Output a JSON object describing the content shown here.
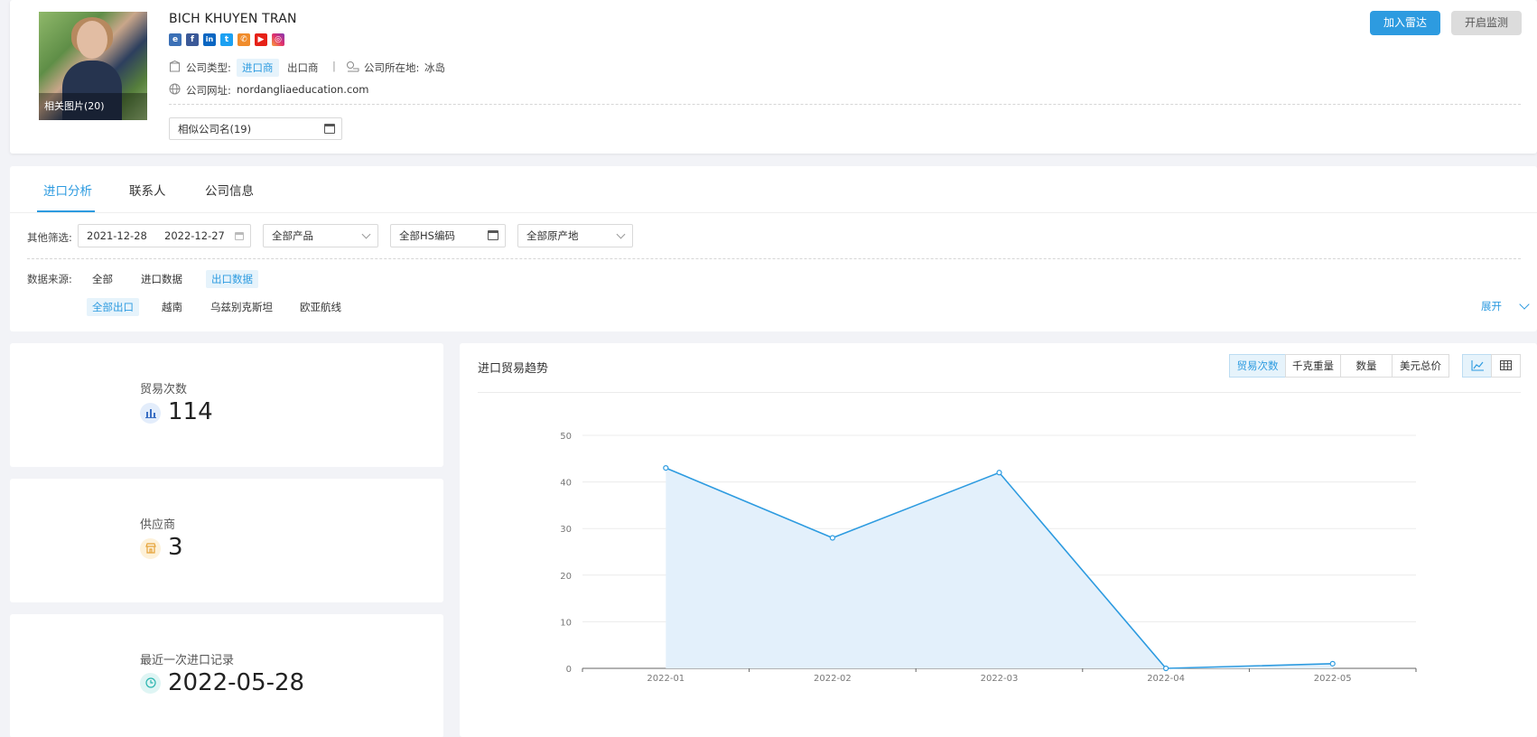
{
  "profile": {
    "photo_caption": "相关图片(20)",
    "name": "BICH KHUYEN TRAN",
    "social_icons": [
      "ie-icon",
      "facebook-icon",
      "linkedin-icon",
      "twitter-icon",
      "phone-icon",
      "youtube-icon",
      "instagram-icon"
    ],
    "company_type_label": "公司类型:",
    "company_type_importer": "进口商",
    "company_type_exporter": "出口商",
    "separator": "|",
    "location_label": "公司所在地:",
    "location_value": "冰岛",
    "website_label": "公司网址:",
    "website_value": "nordangliaeducation.com",
    "similar_names": "相似公司名(19)",
    "add_radar_button": "加入雷达",
    "monitor_button": "开启监测"
  },
  "tabs": [
    "进口分析",
    "联系人",
    "公司信息"
  ],
  "filters": {
    "label": "其他筛选:",
    "date_start": "2021-12-28",
    "date_end": "2022-12-27",
    "product": "全部产品",
    "hs_code": "全部HS编码",
    "origin": "全部原产地"
  },
  "source": {
    "label": "数据来源:",
    "options": [
      "全部",
      "进口数据",
      "出口数据"
    ],
    "sub_options": [
      "全部出口",
      "越南",
      "乌兹别克斯坦",
      "欧亚航线"
    ],
    "expand": "展开"
  },
  "stats": {
    "trade_count_label": "贸易次数",
    "trade_count_value": "114",
    "supplier_label": "供应商",
    "supplier_value": "3",
    "last_record_label": "最近一次进口记录",
    "last_record_value": "2022-05-28"
  },
  "chart_panel": {
    "title": "进口贸易趋势",
    "metric_buttons": [
      "贸易次数",
      "千克重量",
      "数量",
      "美元总价"
    ],
    "view_icons": [
      "line-chart-icon",
      "table-icon"
    ]
  },
  "colors": {
    "accent": "#2d9be0",
    "area_fill": "#e3f0fb"
  },
  "chart_data": {
    "type": "area",
    "categories": [
      "2022-01",
      "2022-02",
      "2022-03",
      "2022-04",
      "2022-05"
    ],
    "values": [
      43,
      28,
      42,
      0,
      1
    ],
    "yticks": [
      "0",
      "10",
      "20",
      "30",
      "40",
      "50"
    ],
    "ylim": [
      0,
      50
    ],
    "grid": true,
    "title": "",
    "xlabel": "",
    "ylabel": ""
  }
}
